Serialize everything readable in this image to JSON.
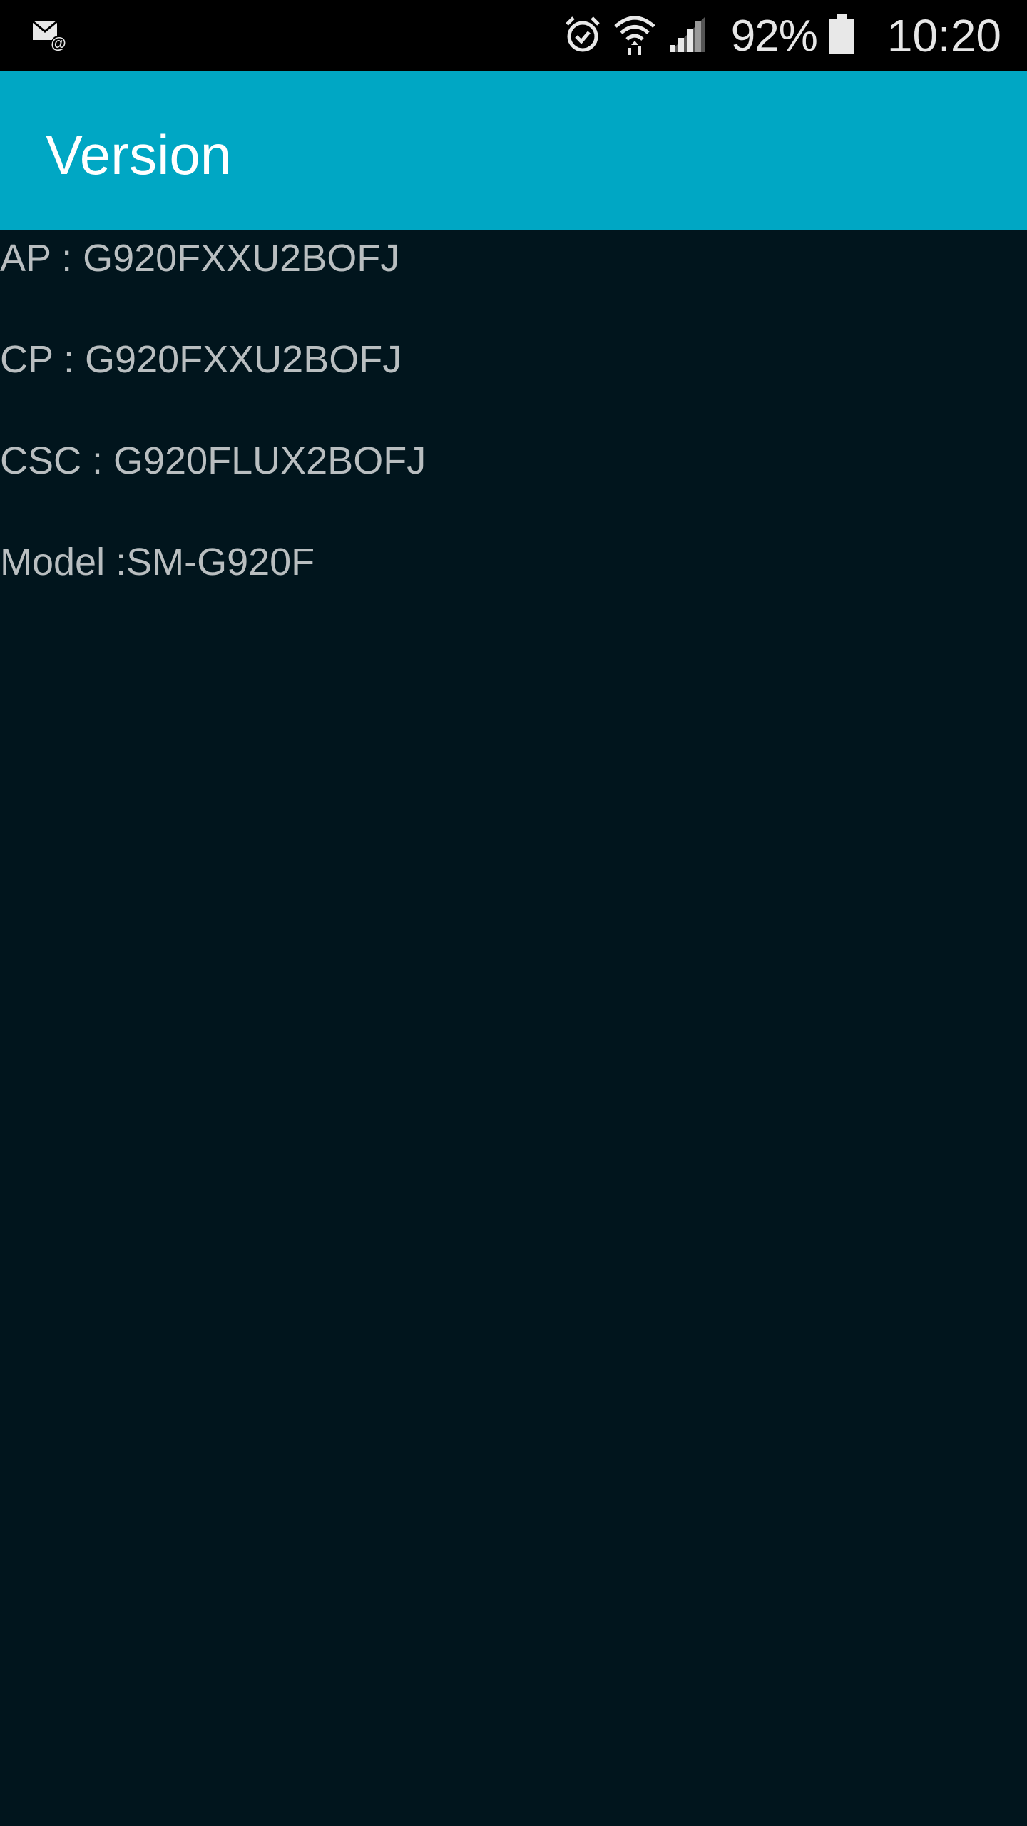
{
  "status_bar": {
    "notification_icon": "email-at-icon",
    "alarm_icon": "alarm-icon",
    "wifi_icon": "wifi-icon",
    "signal_icon": "cellular-signal-icon",
    "battery_percent": "92%",
    "battery_icon": "battery-icon",
    "time": "10:20"
  },
  "app_bar": {
    "title": "Version",
    "color": "#00a7c4"
  },
  "info": {
    "ap": "AP : G920FXXU2BOFJ",
    "cp": "CP : G920FXXU2BOFJ",
    "csc": "CSC : G920FLUX2BOFJ",
    "model": "Model :SM-G920F"
  },
  "colors": {
    "background": "#01151d",
    "text": "#b9bec0"
  }
}
